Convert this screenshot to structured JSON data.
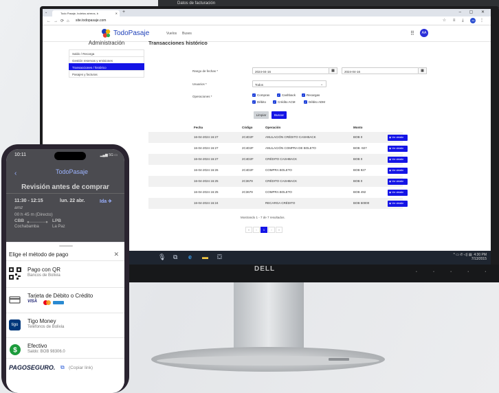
{
  "top_strip": {
    "text": "Datos de facturación"
  },
  "browser": {
    "tab_title": "Todo Pasaje, boletos aéreos, b",
    "url": "site.todopasaje.com",
    "avatar": "AA"
  },
  "site": {
    "brand": "TodoPasaje",
    "nav": [
      "Vuelos",
      "Buses"
    ],
    "user_initials": "AA"
  },
  "sidebar": {
    "title": "Administración",
    "items": [
      {
        "label": "Saldo / Recarga"
      },
      {
        "label": "Gestión reservas y emisiones"
      },
      {
        "label": "Transacciones / histórico",
        "active": true
      },
      {
        "label": "Pasajes y facturas"
      }
    ]
  },
  "main": {
    "title": "Transacciones histórico",
    "date_range_label": "Rango de fechas *",
    "date_from": "2024-04-16",
    "date_to": "2024-04-16",
    "users_label": "Usuarios *",
    "users_value": "Todos",
    "ops_label": "Operaciones *",
    "ops": [
      "Compras",
      "Cashback",
      "Recargas",
      "Débito",
      "Crédito ACM",
      "Débito ADM"
    ],
    "clear_label": "Limpiar",
    "search_label": "Buscar"
  },
  "table": {
    "headers": [
      "Fecha",
      "Código",
      "Operación",
      "Monto"
    ],
    "detail_label": "Ver detalle",
    "rows": [
      {
        "fecha": "16-04-2024 16:27",
        "codigo": "2C4D2F",
        "op": "ANULACIÓN CRÉDITO CASHBACK",
        "monto": "BOB 0"
      },
      {
        "fecha": "16-04-2024 16:27",
        "codigo": "2C4D2F",
        "op": "ANULACIÓN COMPRA DE BOLETO",
        "monto": "BOB -927"
      },
      {
        "fecha": "16-04-2024 16:27",
        "codigo": "2C4D2F",
        "op": "CRÉDITO CASHBACK",
        "monto": "BOB 0"
      },
      {
        "fecha": "16-04-2024 16:26",
        "codigo": "2C4D2F",
        "op": "COMPRA BOLETO",
        "monto": "BOB 927"
      },
      {
        "fecha": "16-04-2024 16:25",
        "codigo": "2C3679",
        "op": "CRÉDITO CASHBACK",
        "monto": "BOB 0"
      },
      {
        "fecha": "16-04-2024 16:25",
        "codigo": "2C3679",
        "op": "COMPRA BOLETO",
        "monto": "BOB 492"
      },
      {
        "fecha": "16-04-2024 16:24",
        "codigo": "",
        "op": "RECARGA CRÉDITO",
        "monto": "BOB 50000"
      }
    ],
    "pager_info": "Mostrando 1 - 7 de 7 resultados.",
    "pager": [
      "«",
      "‹",
      "1",
      "›",
      "»"
    ],
    "current_page": "1"
  },
  "taskbar": {
    "time": "4:30 PM",
    "date": "7/13/2015"
  },
  "monitor_brand": "DELL",
  "phone": {
    "time": "10:11",
    "signal": "5G",
    "brand": "TodoPasaje",
    "title": "Revisión antes de comprar",
    "trip_time": "11:30 - 12:15",
    "trip_date": "lun. 22 abr.",
    "direction": "Ida",
    "airline_mark": "amz",
    "duration": "00 h 45 m (Directo)",
    "origin": "CBB",
    "origin_city": "Cochabamba",
    "dest": "LPB",
    "dest_city": "La Paz",
    "sheet_title": "Elige el método de pago",
    "options": [
      {
        "title": "Pago con QR",
        "subtitle": "Bancos de Bolivia",
        "icon": "qr-icon"
      },
      {
        "title": "Tarjeta de Débito o Crédito",
        "subtitle": "VISA",
        "icon": "card-icon"
      },
      {
        "title": "Tigo Money",
        "subtitle": "Teléfonos de Bolivia",
        "icon": "tigo-icon"
      },
      {
        "title": "Efectivo",
        "subtitle": "Saldo: BOB 98306.0",
        "icon": "cash-icon"
      }
    ],
    "pagoseguro": "PAGOSEGURO.",
    "copy_link": "(Copiar link)"
  }
}
